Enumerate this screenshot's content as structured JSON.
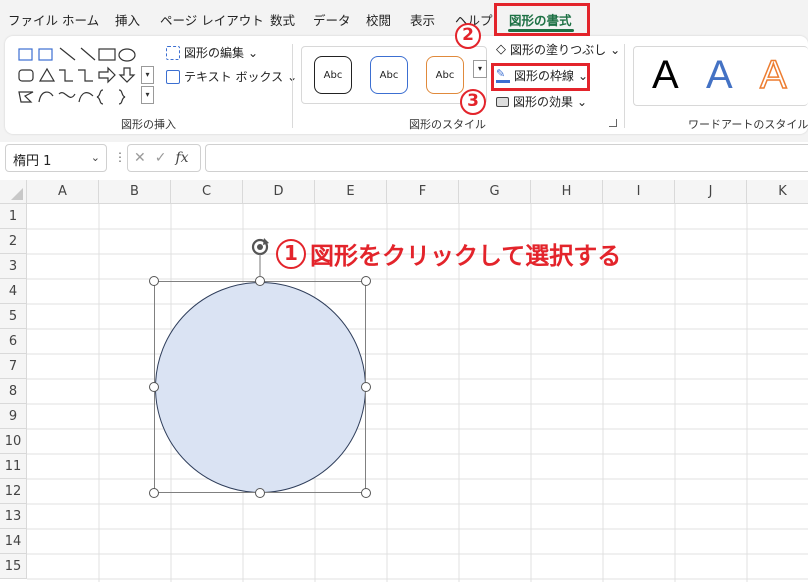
{
  "tabs": [
    "ファイル",
    "ホーム",
    "挿入",
    "ページ レイアウト",
    "数式",
    "データ",
    "校閲",
    "表示",
    "ヘルプ",
    "図形の書式"
  ],
  "active_tab": "図形の書式",
  "ribbon": {
    "insert_shapes_group": "図形の挿入",
    "edit_shape": "図形の編集",
    "text_box": "テキスト ボックス",
    "shape_styles_group": "図形のスタイル",
    "style_sample": "Abc",
    "shape_fill": "図形の塗りつぶし",
    "shape_outline": "図形の枠線",
    "shape_effects": "図形の効果",
    "wordart_group": "ワードアートのスタイル",
    "wordart_sample": "A"
  },
  "formula_bar": {
    "name_box": "楕円 1",
    "fx": "fx",
    "value": ""
  },
  "columns": [
    "A",
    "B",
    "C",
    "D",
    "E",
    "F",
    "G",
    "H",
    "I",
    "J",
    "K"
  ],
  "rows": [
    "1",
    "2",
    "3",
    "4",
    "5",
    "6",
    "7",
    "8",
    "9",
    "10",
    "11",
    "12",
    "13",
    "14",
    "15"
  ],
  "annotations": {
    "step1_number": "1",
    "step1_text": "図形をクリックして選択する",
    "step2_number": "2",
    "step3_number": "3"
  },
  "colors": {
    "accent": "#1e7145",
    "annotation": "#e3242b",
    "shape_fill": "#dae3f3"
  }
}
